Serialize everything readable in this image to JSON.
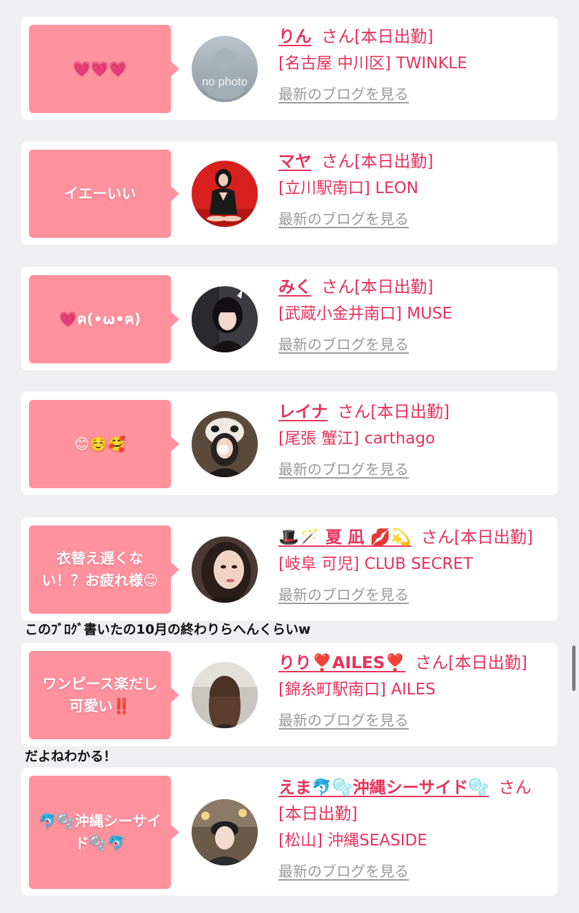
{
  "cards": [
    {
      "comment": "💗💗💗",
      "name": "りん",
      "honorific": "さん",
      "status": "[本日出勤]",
      "shop": "[名古屋 中川区] TWINKLE",
      "blog_link": "最新のブログを見る",
      "avatar_text": "no photo",
      "avatar_icon": "no-photo-placeholder"
    },
    {
      "comment": "イエーいい",
      "name": "マヤ",
      "honorific": "さん",
      "status": "[本日出勤]",
      "shop": "[立川駅南口] LEON",
      "blog_link": "最新のブログを見る",
      "avatar_icon": "profile-photo"
    },
    {
      "comment": "💗ฅ(•ω•ฅ)",
      "name": "みく",
      "honorific": "さん",
      "status": "[本日出勤]",
      "shop": "[武蔵小金井南口] MUSE",
      "blog_link": "最新のブログを見る",
      "avatar_icon": "profile-photo"
    },
    {
      "comment": "😊☺️🥰",
      "name": "レイナ",
      "honorific": "さん",
      "status": "[本日出勤]",
      "shop": "[尾張 蟹江] carthago",
      "blog_link": "最新のブログを見る",
      "avatar_icon": "profile-photo"
    },
    {
      "comment": "衣替え遅くない！？お疲れ様😊",
      "name": "🎩🪄 夏 凪 💋💫",
      "honorific": "さん",
      "status": "[本日出勤]",
      "shop": "[岐阜 可児] CLUB SECRET",
      "blog_link": "最新のブログを見る",
      "avatar_icon": "profile-photo"
    },
    {
      "comment": "ワンピース楽だし可愛い‼️",
      "name": "りり❣️AILES❣️",
      "honorific": "さん",
      "status": "[本日出勤]",
      "shop": "[錦糸町駅南口] AILES",
      "blog_link": "最新のブログを見る",
      "avatar_icon": "profile-photo"
    },
    {
      "comment": "🐬🫧沖縄シーサイド🫧🐬",
      "name": "えま🐬🫧沖縄シーサイド🫧",
      "honorific": "さん",
      "status": "[本日出勤]",
      "shop": "[松山] 沖縄SEASIDE",
      "blog_link": "最新のブログを見る",
      "avatar_icon": "profile-photo"
    }
  ],
  "captions": [
    "このﾌﾞﾛｸﾞ書いたの10月の終わりらへんくらいw",
    "だよねわかる！"
  ],
  "colors": {
    "accent": "#e7315a",
    "bubble": "#ff929d",
    "background": "#efeff1",
    "link_gray": "#9a9a9a"
  }
}
